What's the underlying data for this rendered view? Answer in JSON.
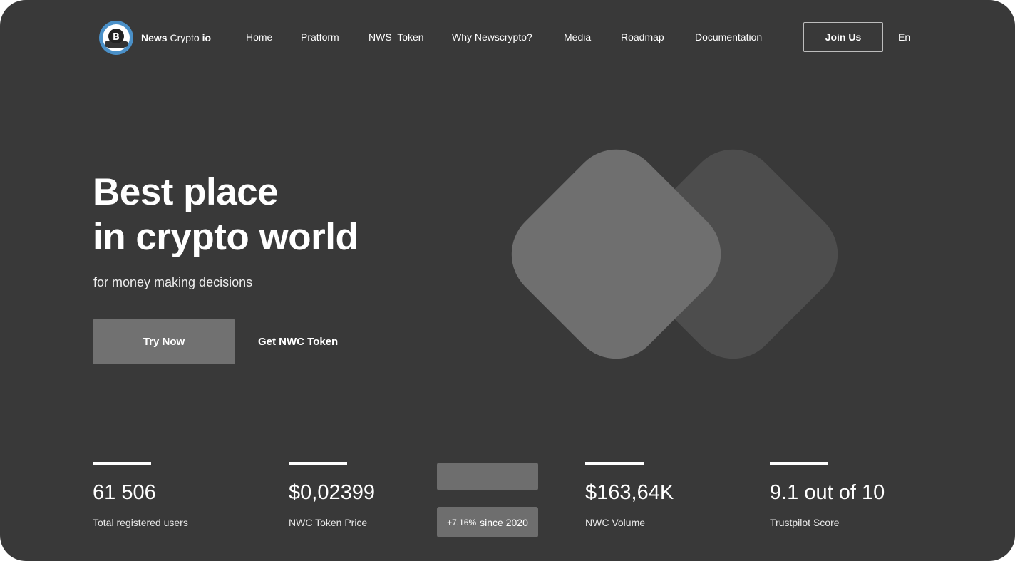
{
  "brand": {
    "name_bold": "News",
    "name_light": "Crypto",
    "name_suffix": "io",
    "logo_icon": "bitcoin-hands-icon",
    "logo_color": "#4a90c8",
    "logo_letter": "B"
  },
  "nav": {
    "items": [
      "Home",
      "Pratform",
      "NWS  Token",
      "Why Newscrypto?",
      "Media",
      "Roadmap",
      "Documentation"
    ],
    "join_label": "Join Us",
    "language": "En"
  },
  "hero": {
    "title_line1": "Best place",
    "title_line2": "in crypto world",
    "subtitle": "for money making decisions",
    "primary_cta": "Try Now",
    "secondary_cta": "Get NWC Token"
  },
  "stats": [
    {
      "value": "61 506",
      "label": "Total registered users"
    },
    {
      "value": "$0,02399",
      "label": "NWC Token Price"
    },
    {
      "value": "$163,64K",
      "label": "NWC Volume"
    },
    {
      "value": "9.1 out of 10",
      "label": "Trustpilot Score"
    }
  ],
  "price_change": {
    "percent": "+7.16%",
    "since": "since 2020"
  },
  "colors": {
    "background": "#393939",
    "accent_gray": "#717171",
    "shape_front": "#6f6f6f",
    "shape_back": "#4d4d4d"
  }
}
